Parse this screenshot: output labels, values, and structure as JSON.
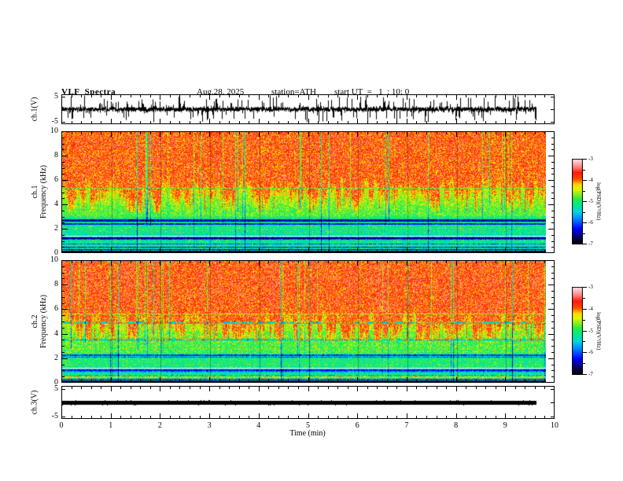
{
  "header": {
    "title": "VLF  Spectra",
    "date": "Aug.28, 2025",
    "station": "station=ATH",
    "start_ut": "start UT  =   1  : 10: 0"
  },
  "axes": {
    "time_label": "Time  (min)",
    "time_major_ticks": [
      0,
      1,
      2,
      3,
      4,
      5,
      6,
      7,
      8,
      9,
      10
    ],
    "time_minor_per_major": 5,
    "time_range": [
      0,
      10
    ],
    "freq_major_ticks": [
      0,
      2,
      4,
      6,
      8,
      10
    ],
    "freq_minor_step": 0.5,
    "freq_range": [
      0,
      10
    ],
    "volt_ticks": [
      5,
      -5
    ],
    "volt_range": [
      -6,
      6
    ]
  },
  "panels": {
    "wave1": {
      "label": "ch.1(V)"
    },
    "spec1": {
      "label_line1": "ch.1",
      "label_line2": "Frequency  (kHz)"
    },
    "spec2": {
      "label_line1": "ch.2",
      "label_line2": "Frequency  (kHz)"
    },
    "wave3": {
      "label": "ch.3(V)"
    }
  },
  "colorbar": {
    "label": "log(PSD)(V²/Hz)",
    "ticks": [
      -3,
      -4,
      -5,
      -6,
      -7
    ],
    "minor_ticks": [
      -3.5,
      -4.5,
      -5.5,
      -6.5
    ],
    "max": -3,
    "min": -7
  },
  "chart_data": {
    "type": "heatmap",
    "title": "VLF Spectra",
    "xlabel": "Time (min)",
    "time_range_min": [
      0,
      10
    ],
    "data_end_min": 9.81,
    "freq_range_khz": [
      0,
      10
    ],
    "psd_log_range": [
      -7,
      -3
    ],
    "colormap_stops": [
      [
        0.0,
        [
          0,
          0,
          0
        ]
      ],
      [
        0.06,
        [
          8,
          0,
          70
        ]
      ],
      [
        0.18,
        [
          0,
          0,
          255
        ]
      ],
      [
        0.3,
        [
          0,
          140,
          255
        ]
      ],
      [
        0.38,
        [
          0,
          215,
          225
        ]
      ],
      [
        0.46,
        [
          0,
          235,
          140
        ]
      ],
      [
        0.53,
        [
          45,
          235,
          65
        ]
      ],
      [
        0.64,
        [
          225,
          245,
          0
        ]
      ],
      [
        0.7,
        [
          255,
          215,
          0
        ]
      ],
      [
        0.76,
        [
          255,
          80,
          0
        ]
      ],
      [
        0.84,
        [
          255,
          25,
          10
        ]
      ],
      [
        0.9,
        [
          255,
          120,
          120
        ]
      ],
      [
        1.0,
        [
          255,
          235,
          235
        ]
      ]
    ],
    "waveform_ch1": {
      "ylim": [
        -6,
        6
      ],
      "mean": 0,
      "core_half": 0.75,
      "spike_prob": 0.28,
      "spike_max": 4.2,
      "seed": 11
    },
    "waveform_ch3": {
      "ylim": [
        -6,
        6
      ],
      "value": 0,
      "thickness_px": 5,
      "seed": 3
    },
    "spectrogram_ch1": {
      "seed": 101,
      "base_points": [
        [
          10,
          -3.8
        ],
        [
          6.4,
          -3.82
        ],
        [
          5.6,
          -4.25
        ],
        [
          4.6,
          -4.6
        ],
        [
          3.6,
          -4.8
        ],
        [
          3.0,
          -4.85
        ],
        [
          2.8,
          -5.1
        ],
        [
          2.4,
          -5.15
        ],
        [
          1.35,
          -5.25
        ],
        [
          1.18,
          -5.85
        ],
        [
          0.95,
          -5.3
        ],
        [
          0.5,
          -5.05
        ],
        [
          0.3,
          -5.3
        ],
        [
          0.0,
          -5.6
        ]
      ],
      "grass": {
        "base": 4.8,
        "amp": 1.3,
        "tree_prob": 0.1,
        "tree_max": 2.2,
        "red": -3.82,
        "yellow": -4.42
      },
      "lines": [
        {
          "f": 5.35,
          "l": -4.75,
          "w": 1
        },
        {
          "f": 2.72,
          "l": -6.3,
          "w": 2
        },
        {
          "f": 2.55,
          "l": -6.6,
          "w": 1
        },
        {
          "f": 2.37,
          "l": -6.2,
          "w": 2
        },
        {
          "f": 1.3,
          "rgb": [
            235,
            245,
            248
          ],
          "w": 1
        },
        {
          "f": 1.18,
          "l": -6.6,
          "w": 2
        },
        {
          "f": 1.02,
          "l": -6.1,
          "w": 1
        },
        {
          "f": 0.65,
          "l": -6.0,
          "w": 1
        },
        {
          "f": 0.42,
          "l": -6.3,
          "w": 1
        },
        {
          "f": 0.22,
          "l": -6.5,
          "w": 1
        },
        {
          "f": 0.08,
          "l": -6.8,
          "w": 2
        }
      ],
      "speckle_bands": [
        {
          "lo": 1.5,
          "hi": 2.25,
          "p": 0.05,
          "b": 0.8
        },
        {
          "lo": 0.8,
          "hi": 1.1,
          "p": 0.12,
          "b": 0.55
        },
        {
          "lo": 0.05,
          "hi": 0.45,
          "p": 0.1,
          "b": 0.7
        }
      ],
      "dark_col": {
        "p": 0.045,
        "smin": 0.5,
        "smax": 1.5,
        "full_prob": 0.5
      }
    },
    "spectrogram_ch2": {
      "seed": 202,
      "base_points": [
        [
          10,
          -3.75
        ],
        [
          6.0,
          -3.8
        ],
        [
          5.2,
          -4.3
        ],
        [
          4.6,
          -4.55
        ],
        [
          4.0,
          -4.75
        ],
        [
          3.0,
          -4.85
        ],
        [
          2.4,
          -4.9
        ],
        [
          2.1,
          -5.4
        ],
        [
          1.85,
          -5.0
        ],
        [
          1.1,
          -5.15
        ],
        [
          0.9,
          -5.65
        ],
        [
          0.6,
          -5.0
        ],
        [
          0.35,
          -4.9
        ],
        [
          0.0,
          -5.5
        ]
      ],
      "grass": {
        "base": 4.5,
        "amp": 1.4,
        "tree_prob": 0.12,
        "tree_max": 2.4,
        "red": -3.78,
        "yellow": -4.42
      },
      "lines": [
        {
          "f": 5.6,
          "l": -4.5,
          "w": 1
        },
        {
          "f": 4.95,
          "l": -4.05,
          "w": 2,
          "broken": true
        },
        {
          "f": 4.82,
          "l": -5.3,
          "w": 1
        },
        {
          "f": 3.55,
          "l": -4.0,
          "w": 2,
          "broken": true
        },
        {
          "f": 3.42,
          "l": -5.2,
          "w": 1
        },
        {
          "f": 2.2,
          "l": -6.1,
          "w": 2
        },
        {
          "f": 2.0,
          "l": -5.9,
          "w": 1
        },
        {
          "f": 1.12,
          "rgb": [
            235,
            245,
            248
          ],
          "w": 1
        },
        {
          "f": 1.0,
          "l": -6.2,
          "w": 2
        },
        {
          "f": 0.82,
          "l": -5.9,
          "w": 1
        },
        {
          "f": 0.5,
          "l": -5.7,
          "w": 1
        },
        {
          "f": 0.35,
          "l": -4.5,
          "w": 1
        },
        {
          "f": 0.18,
          "l": -6.3,
          "w": 1
        },
        {
          "f": 0.07,
          "l": -6.7,
          "w": 2
        }
      ],
      "speckle_bands": [
        {
          "lo": 2.35,
          "hi": 3.1,
          "p": 0.1,
          "b": 0.45
        },
        {
          "lo": 1.15,
          "hi": 1.5,
          "p": 0.06,
          "b": 0.6
        },
        {
          "lo": 0.25,
          "hi": 0.5,
          "p": 0.25,
          "b": 0.8
        }
      ],
      "dark_col": {
        "p": 0.05,
        "smin": 0.5,
        "smax": 1.6,
        "full_prob": 0.5
      }
    }
  }
}
